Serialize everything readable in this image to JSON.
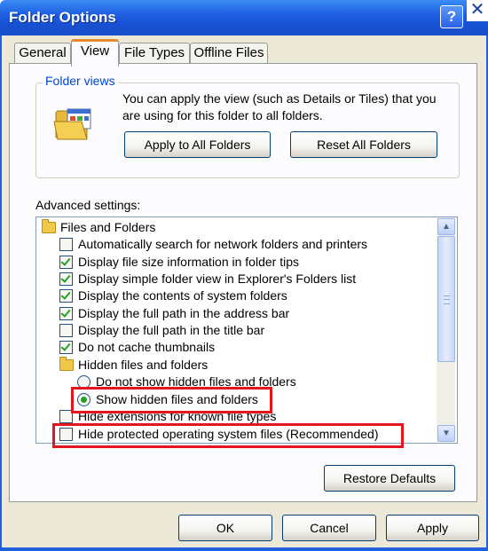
{
  "window": {
    "title": "Folder Options",
    "help_glyph": "?",
    "close_glyph": "✕"
  },
  "tabs": [
    {
      "label": "General"
    },
    {
      "label": "View"
    },
    {
      "label": "File Types"
    },
    {
      "label": "Offline Files"
    }
  ],
  "folder_views": {
    "legend": "Folder views",
    "description": "You can apply the view (such as Details or Tiles) that you are using for this folder to all folders.",
    "apply_button": "Apply to All Folders",
    "reset_button": "Reset All Folders"
  },
  "advanced": {
    "label": "Advanced settings:",
    "items": [
      {
        "type": "folder",
        "label": "Files and Folders"
      },
      {
        "type": "checkbox",
        "checked": false,
        "label": "Automatically search for network folders and printers"
      },
      {
        "type": "checkbox",
        "checked": true,
        "label": "Display file size information in folder tips"
      },
      {
        "type": "checkbox",
        "checked": true,
        "label": "Display simple folder view in Explorer's Folders list"
      },
      {
        "type": "checkbox",
        "checked": true,
        "label": "Display the contents of system folders"
      },
      {
        "type": "checkbox",
        "checked": true,
        "label": "Display the full path in the address bar"
      },
      {
        "type": "checkbox",
        "checked": false,
        "label": "Display the full path in the title bar"
      },
      {
        "type": "checkbox",
        "checked": true,
        "label": "Do not cache thumbnails"
      },
      {
        "type": "folder",
        "label": "Hidden files and folders"
      },
      {
        "type": "radio",
        "checked": false,
        "label": "Do not show hidden files and folders"
      },
      {
        "type": "radio",
        "checked": true,
        "label": "Show hidden files and folders"
      },
      {
        "type": "checkbox",
        "checked": false,
        "label": "Hide extensions for known file types"
      },
      {
        "type": "checkbox",
        "checked": false,
        "label": "Hide protected operating system files (Recommended)"
      }
    ]
  },
  "restore_button": "Restore Defaults",
  "footer": {
    "ok": "OK",
    "cancel": "Cancel",
    "apply": "Apply"
  },
  "colors": {
    "titlebar": "#1f5fe0",
    "dialog_bg": "#ece9d8",
    "legend": "#0046d5",
    "check": "#21a121",
    "highlight": "#e3161f",
    "tab_accent": "#e68b2c"
  },
  "icons": {
    "folder_views": "folder-with-window-icon",
    "scroll_up": "chevron-up-icon",
    "scroll_down": "chevron-down-icon"
  }
}
